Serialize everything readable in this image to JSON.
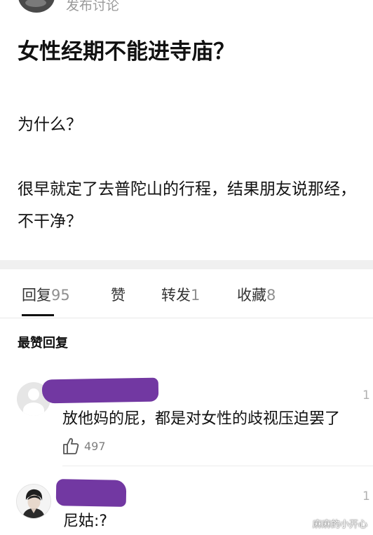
{
  "post": {
    "meta_fragment": "发布讨论",
    "title": "女性经期不能进寺庙？",
    "question": "为什么？",
    "body": "很早就定了去普陀山的行程，结果朋友说那经，不干净？"
  },
  "tabs": [
    {
      "label": "回复",
      "count": "95",
      "active": true
    },
    {
      "label": "赞",
      "count": "",
      "active": false
    },
    {
      "label": "转发",
      "count": "1",
      "active": false
    },
    {
      "label": "收藏",
      "count": "8",
      "active": false
    }
  ],
  "section": {
    "heading": "最赞回复"
  },
  "comments": [
    {
      "text": "放他妈的屁，都是对女性的歧视压迫罢了",
      "likes": "497",
      "time_fragment": "1",
      "username_redacted": true
    },
    {
      "text": "尼姑:?",
      "time_fragment": "1",
      "username_redacted": true
    }
  ],
  "watermark": "麻麻的小开心",
  "colors": {
    "redaction": "#6f3a9a",
    "text": "#111111",
    "muted": "#8f8f8f",
    "separator": "#f0f0f0"
  }
}
